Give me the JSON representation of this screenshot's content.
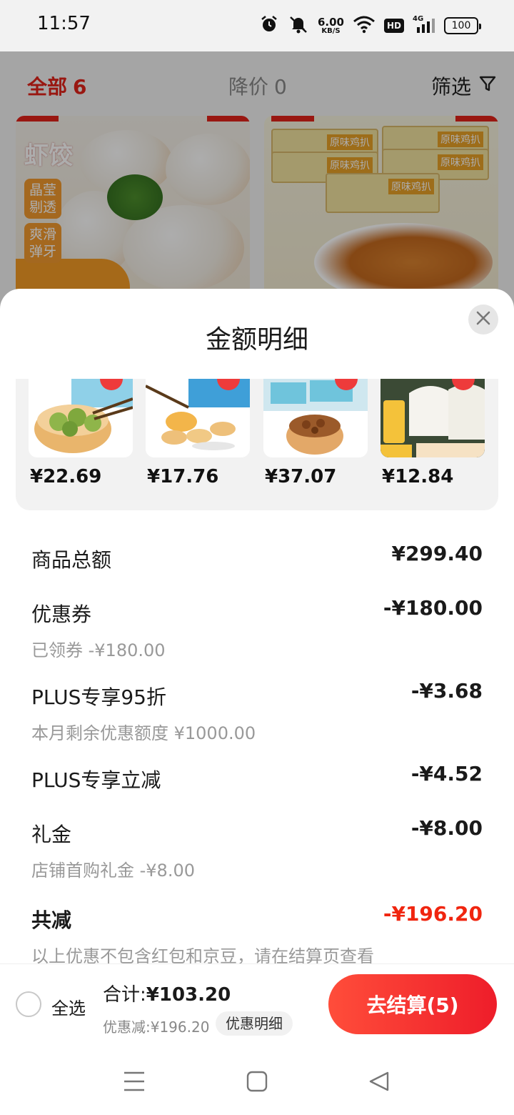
{
  "status_bar": {
    "time": "11:57",
    "net_speed_value": "6.00",
    "net_speed_unit": "KB/S",
    "hd": "HD",
    "signal": "4G",
    "battery": "100"
  },
  "cart": {
    "tab_all_label": "全部",
    "tab_all_count": "6",
    "tab_drop_label": "降价",
    "tab_drop_count": "0",
    "filter_label": "筛选",
    "product_left": {
      "title": "虾饺",
      "tag1": "晶莹剔透",
      "tag2": "爽滑弹牙"
    },
    "product_right": {
      "pack_label": "原味鸡扒"
    }
  },
  "sheet": {
    "title": "金额明细",
    "thumbnails": [
      {
        "price": "¥22.69",
        "icon": "shaomai-thumbnail"
      },
      {
        "price": "¥17.76",
        "icon": "potsticker-thumbnail"
      },
      {
        "price": "¥37.07",
        "icon": "chicken-feet-thumbnail"
      },
      {
        "price": "¥12.84",
        "icon": "rice-cake-thumbnail"
      }
    ],
    "rows": {
      "subtotal_label": "商品总额",
      "subtotal_value": "¥299.40",
      "coupon_label": "优惠券",
      "coupon_value": "-¥180.00",
      "coupon_sub": "已领券 -¥180.00",
      "plus95_label": "PLUS专享95折",
      "plus95_value": "-¥3.68",
      "plus95_sub": "本月剩余优惠额度 ¥1000.00",
      "plus_reduce_label": "PLUS专享立减",
      "plus_reduce_value": "-¥4.52",
      "gift_label": "礼金",
      "gift_value": "-¥8.00",
      "gift_sub": "店铺首购礼金 -¥8.00",
      "total_label": "共减",
      "total_value": "-¥196.20",
      "note": "以上优惠不包含红包和京豆，请在结算页查看"
    }
  },
  "checkout": {
    "select_all": "全选",
    "sum_prefix": "合计:",
    "sum_amount": "¥103.20",
    "discount_text": "优惠减:¥196.20",
    "detail_button": "优惠明细",
    "checkout_button": "去结算(5)"
  },
  "colors": {
    "accent": "#e2231a",
    "total_red": "#f0250f"
  }
}
